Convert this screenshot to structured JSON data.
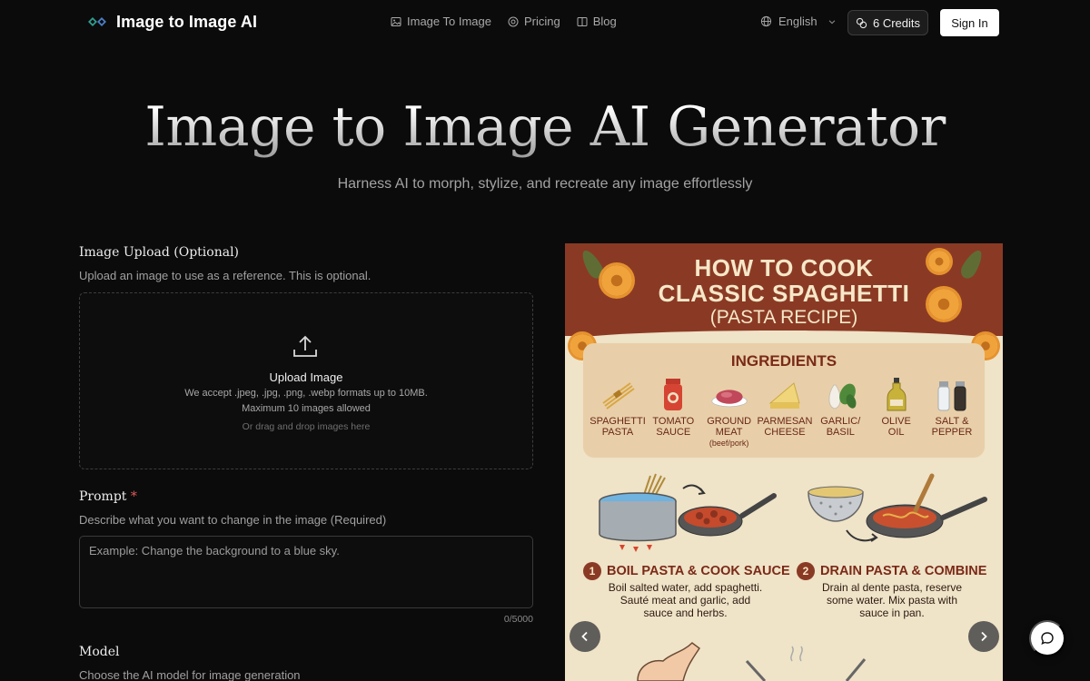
{
  "header": {
    "brand": "Image to Image AI",
    "nav": [
      {
        "label": "Image To Image",
        "icon": "image-icon"
      },
      {
        "label": "Pricing",
        "icon": "pricing-icon"
      },
      {
        "label": "Blog",
        "icon": "book-icon"
      }
    ],
    "language": "English",
    "credits": "6 Credits",
    "signin": "Sign In"
  },
  "hero": {
    "title": "Image to Image AI Generator",
    "subtitle": "Harness AI to morph, stylize, and recreate any image effortlessly"
  },
  "upload": {
    "title": "Image Upload (Optional)",
    "description": "Upload an image to use as a reference. This is optional.",
    "label": "Upload Image",
    "formats": "We accept .jpeg, .jpg, .png, .webp formats up to 10MB.",
    "max": "Maximum 10 images allowed",
    "drag": "Or drag and drop images here"
  },
  "prompt": {
    "title": "Prompt",
    "required_mark": "*",
    "description": "Describe what you want to change in the image (Required)",
    "placeholder": "Example: Change the background to a blue sky.",
    "counter": "0/5000"
  },
  "model": {
    "title": "Model",
    "description": "Choose the AI model for image generation"
  },
  "preview": {
    "title_line1": "HOW TO COOK",
    "title_line2": "CLASSIC SPAGHETTI",
    "title_line3": "(PASTA RECIPE)",
    "ingredients_heading": "INGREDIENTS",
    "ingredients": [
      {
        "line1": "SPAGHETTI",
        "line2": "PASTA",
        "note": ""
      },
      {
        "line1": "TOMATO",
        "line2": "SAUCE",
        "note": ""
      },
      {
        "line1": "GROUND",
        "line2": "MEAT",
        "note": "(beef/pork)"
      },
      {
        "line1": "PARMESAN",
        "line2": "CHEESE",
        "note": ""
      },
      {
        "line1": "GARLIC/",
        "line2": "BASIL",
        "note": ""
      },
      {
        "line1": "OLIVE",
        "line2": "OIL",
        "note": ""
      },
      {
        "line1": "SALT &",
        "line2": "PEPPER",
        "note": ""
      }
    ],
    "step1": {
      "num": "1",
      "title": "BOIL PASTA & COOK SAUCE",
      "line1": "Boil salted water, add spaghetti.",
      "line2": "Sauté meat and garlic, add",
      "line3": "sauce and herbs."
    },
    "step2": {
      "num": "2",
      "title": "DRAIN PASTA & COMBINE",
      "line1": "Drain al dente pasta, reserve",
      "line2": "some water. Mix pasta with",
      "line3": "sauce in pan."
    }
  },
  "colors": {
    "background": "#0b0b0b",
    "recipe_banner": "#8a3a24",
    "recipe_bg": "#efe3c8"
  }
}
